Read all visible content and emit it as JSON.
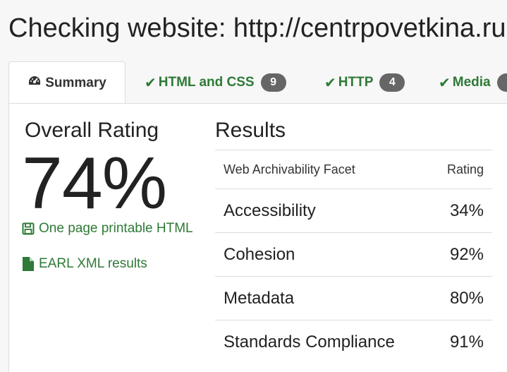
{
  "header": {
    "title": "Checking website: http://centrpovetkina.ru"
  },
  "tabs": [
    {
      "label": "Summary",
      "icon": "dashboard-icon",
      "active": true
    },
    {
      "label": "HTML and CSS",
      "icon": "check-icon",
      "badge": "9"
    },
    {
      "label": "HTTP",
      "icon": "check-icon",
      "badge": "4"
    },
    {
      "label": "Media",
      "icon": "check-icon",
      "badge": ""
    }
  ],
  "summary": {
    "overall_title": "Overall Rating",
    "overall_value": "74%",
    "links": [
      {
        "label": "One page printable HTML",
        "icon": "save-icon"
      },
      {
        "label": "EARL XML results",
        "icon": "file-icon"
      }
    ]
  },
  "results": {
    "title": "Results",
    "columns": [
      "Web Archivability Facet",
      "Rating"
    ],
    "rows": [
      {
        "facet": "Accessibility",
        "rating": "34%"
      },
      {
        "facet": "Cohesion",
        "rating": "92%"
      },
      {
        "facet": "Metadata",
        "rating": "80%"
      },
      {
        "facet": "Standards Compliance",
        "rating": "91%"
      }
    ]
  },
  "colors": {
    "link_green": "#2e7a36",
    "badge_gray": "#666666",
    "border": "#dddddd"
  }
}
